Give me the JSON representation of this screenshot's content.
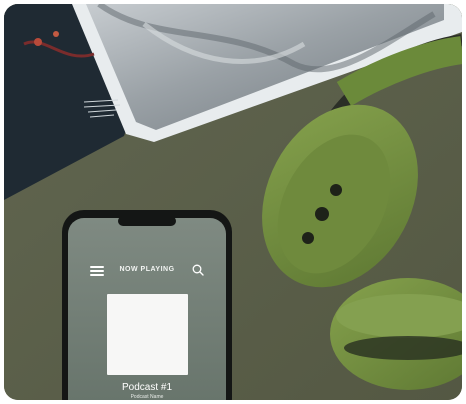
{
  "player": {
    "header_title": "NOW PLAYING",
    "menu_icon": "hamburger-menu-icon",
    "search_icon": "search-icon",
    "track_title": "Podcast #1",
    "track_subtitle": "Podcast Name"
  },
  "colors": {
    "background": "#5b6048",
    "screen": "#6f7c72",
    "headphones": "#74903f",
    "album_art": "#f7f7f6"
  }
}
